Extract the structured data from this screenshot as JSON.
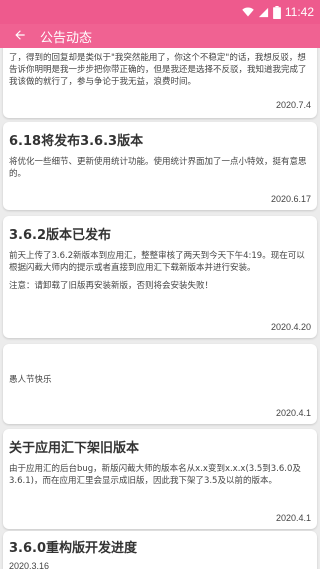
{
  "status_bar": {
    "time": "11:42"
  },
  "app_bar": {
    "title": "公告动态"
  },
  "announcements": [
    {
      "title": "",
      "body": [
        "了，得到的回复却是类似于\"我突然能用了，你这个不稳定\"的话，我想反驳，想告诉你明明是我一步步把你带正确的，但是我还是选择不反驳，我知道我完成了我该做的就行了，参与争论于我无益，浪费时间。"
      ],
      "date": "2020.7.4"
    },
    {
      "title": "6.18将发布3.6.3版本",
      "body": [
        "将优化一些细节、更新使用统计功能。使用统计界面加了一点小特效，挺有意思的。"
      ],
      "date": "2020.6.17"
    },
    {
      "title": "3.6.2版本已发布",
      "body": [
        "前天上传了3.6.2新版本到应用汇，整整审核了两天到今天下午4:19。现在可以根据闪截大师内的提示或者直接到应用汇下载新版本并进行安装。",
        "注意：请卸载了旧版再安装新版，否则将会安装失败！"
      ],
      "date": "2020.4.20"
    },
    {
      "title": "",
      "body": [
        "愚人节快乐"
      ],
      "date": "2020.4.1"
    },
    {
      "title": "关于应用汇下架旧版本",
      "body": [
        "由于应用汇的后台bug，新版闪截大师的版本名从x.x变到x.x.x(3.5到3.6.0及3.6.1)，而在应用汇里会显示成旧版，因此我下架了3.5及以前的版本。"
      ],
      "date": "2020.4.1"
    },
    {
      "title": "3.6.0重构版开发进度",
      "body": [],
      "date": "2020.3.16"
    }
  ],
  "colors": {
    "status_bar": "#ee5a8d",
    "app_bar": "#f06292",
    "background": "#ececec",
    "card": "#ffffff"
  },
  "icons": {
    "back": "arrow-left-icon",
    "wifi": "wifi-icon",
    "signal": "cell-signal-icon",
    "battery": "battery-icon"
  }
}
